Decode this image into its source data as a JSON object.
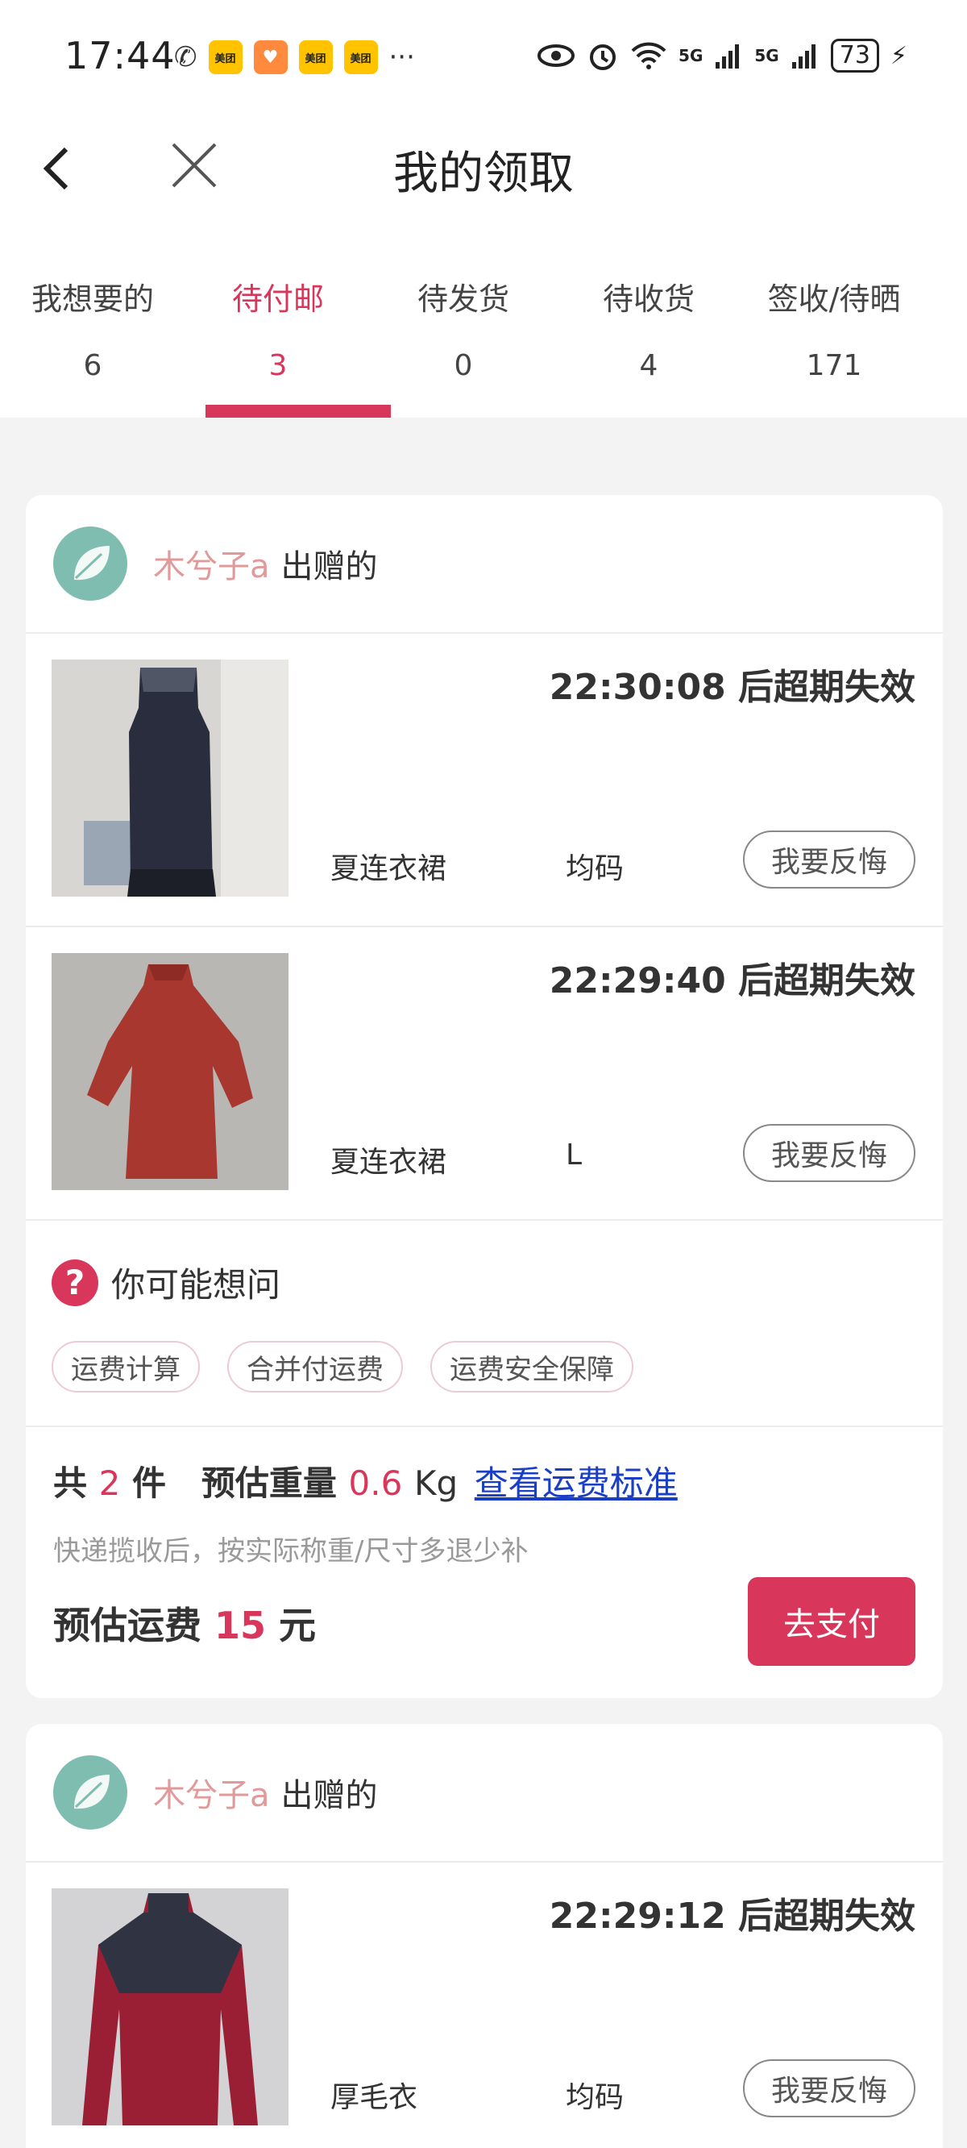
{
  "status_bar": {
    "time": "17:44",
    "app_badge": "美团",
    "overflow": "···",
    "network1": "5G",
    "network2": "5G",
    "battery": "73"
  },
  "header": {
    "title": "我的领取"
  },
  "tabs": [
    {
      "label": "我想要的",
      "count": "6"
    },
    {
      "label": "待付邮",
      "count": "3"
    },
    {
      "label": "待发货",
      "count": "0"
    },
    {
      "label": "待收货",
      "count": "4"
    },
    {
      "label": "签收/待晒",
      "count": "171"
    }
  ],
  "active_tab": "待付邮",
  "colors": {
    "accent": "#d8365b",
    "giver_name": "#e19a9a",
    "link": "#1a3fc4"
  },
  "groups": [
    {
      "giver_name": "木兮子a",
      "giver_suffix": "出赠的",
      "items": [
        {
          "expire": "22:30:08 后超期失效",
          "name": "夏连衣裙",
          "size": "均码",
          "action": "我要反悔"
        },
        {
          "expire": "22:29:40 后超期失效",
          "name": "夏连衣裙",
          "size": "L",
          "action": "我要反悔"
        }
      ],
      "faq": {
        "title": "你可能想问",
        "chips": [
          "运费计算",
          "合并付运费",
          "运费安全保障"
        ]
      },
      "summary": {
        "total_prefix": "共",
        "total_count": "2",
        "total_unit": "件",
        "weight_label": "预估重量",
        "weight_value": "0.6",
        "weight_unit": "Kg",
        "fee_link": "查看运费标准",
        "note": "快递揽收后，按实际称重/尺寸多退少补",
        "fee_label": "预估运费",
        "fee_value": "15",
        "fee_unit": "元",
        "pay": "去支付"
      }
    },
    {
      "giver_name": "木兮子a",
      "giver_suffix": "出赠的",
      "items": [
        {
          "expire": "22:29:12 后超期失效",
          "name": "厚毛衣",
          "size": "均码",
          "action": "我要反悔"
        }
      ]
    }
  ]
}
